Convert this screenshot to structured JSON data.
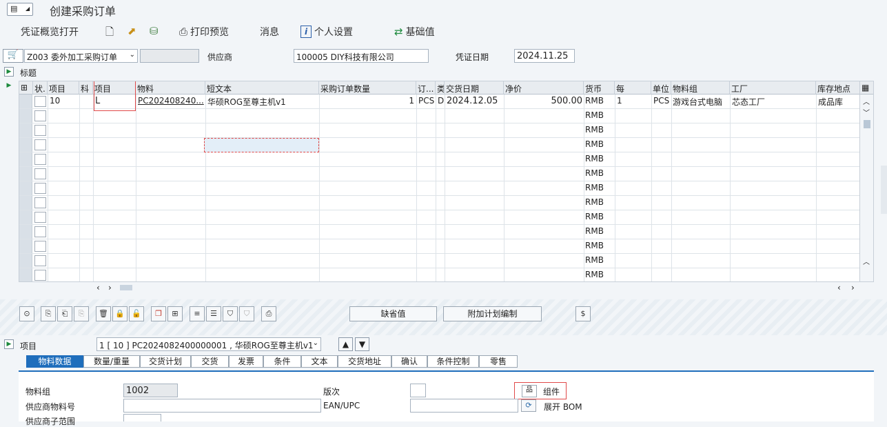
{
  "app": {
    "title": "创建采购订单"
  },
  "toolbar": {
    "overview": "凭证概览打开",
    "print_preview": "打印预览",
    "messages": "消息",
    "personal_settings": "个人设置",
    "base_value": "基础值"
  },
  "header": {
    "order_type": "Z003 委外加工采购订单",
    "supplier_label": "供应商",
    "supplier_value": "100005 DIY科技有限公司",
    "doc_date_label": "凭证日期",
    "doc_date_value": "2024.11.25",
    "title_label": "标题"
  },
  "grid": {
    "headers": [
      "状.",
      "项目",
      "科",
      "项目",
      "物料",
      "短文本",
      "采购订单数量",
      "订...",
      "类",
      "交货日期",
      "净价",
      "货币",
      "每",
      "单位",
      "物料组",
      "工厂",
      "库存地点"
    ],
    "row1": {
      "item": "10",
      "item_cat": "L",
      "material": "PC202408240...",
      "short_text": "华硕ROG至尊主机v1",
      "qty": "1",
      "unit_o": "PCS",
      "cat": "D",
      "delivery_date": "2024.12.05",
      "net_price": "500.00",
      "currency": "RMB",
      "per": "1",
      "unit": "PCS",
      "material_group": "游戏台式电脑",
      "plant": "芯态工厂",
      "storage": "成品库"
    },
    "currency_rows": [
      "RMB",
      "RMB",
      "RMB",
      "RMB",
      "RMB",
      "RMB",
      "RMB",
      "RMB",
      "RMB",
      "RMB",
      "RMB",
      "RMB"
    ]
  },
  "buttons": {
    "default_values": "缺省值",
    "additional_planning": "附加计划编制"
  },
  "item_section": {
    "label": "项目",
    "selector": "1 [ 10 ] PC2024082400000001 , 华硕ROG至尊主机v1"
  },
  "tabs": [
    "物料数据",
    "数量/重量",
    "交货计划",
    "交货",
    "发票",
    "条件",
    "文本",
    "交货地址",
    "确认",
    "条件控制",
    "零售"
  ],
  "detail": {
    "material_group_label": "物料组",
    "material_group_value": "1002",
    "version_label": "版次",
    "components_label": "组件",
    "vendor_material_label": "供应商物料号",
    "ean_label": "EAN/UPC",
    "expand_bom_label": "展开 BOM",
    "vendor_subrange_label": "供应商子范围"
  }
}
